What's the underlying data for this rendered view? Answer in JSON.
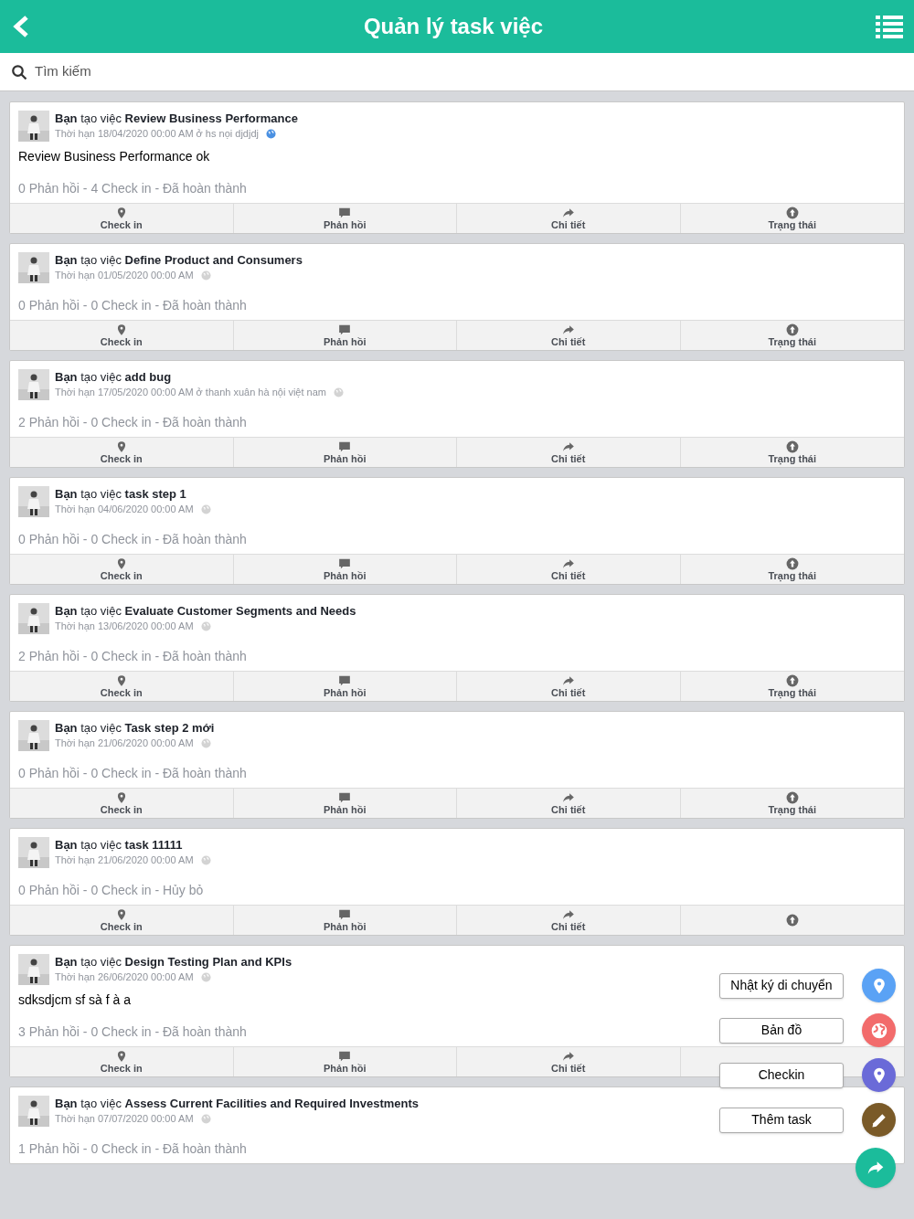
{
  "header": {
    "title": "Quản lý task việc"
  },
  "search": {
    "placeholder": "Tìm kiếm"
  },
  "tasks": [
    {
      "title": "**Bạn** tạo việc **Review Business Performance**",
      "meta": "Thời hạn 18/04/2020 00:00 AM ở hs nọi djdjdj",
      "shared": true,
      "description": "Review Business Performance ok",
      "summary": "0 Phản hồi - 4 Check in - Đã hoàn thành",
      "actions": [
        {
          "kind": "checkin",
          "label": "Check in"
        },
        {
          "kind": "reply",
          "label": "Phản hồi"
        },
        {
          "kind": "detail",
          "label": "Chi tiết"
        },
        {
          "kind": "status",
          "label": "Trạng thái"
        }
      ]
    },
    {
      "title": "**Bạn** tạo việc **Define Product and Consumers**",
      "meta": "Thời hạn 01/05/2020 00:00 AM",
      "shared": false,
      "summary": "0 Phản hồi - 0 Check in - Đã hoàn thành",
      "actions": [
        {
          "kind": "checkin",
          "label": "Check in"
        },
        {
          "kind": "reply",
          "label": "Phản hồi"
        },
        {
          "kind": "detail",
          "label": "Chi tiết"
        },
        {
          "kind": "status",
          "label": "Trạng thái"
        }
      ]
    },
    {
      "title": "**Bạn** tạo việc **add bug**",
      "meta": "Thời hạn 17/05/2020 00:00 AM ở thanh xuân hà nội việt nam",
      "shared": false,
      "summary": "2 Phản hồi - 0 Check in - Đã hoàn thành",
      "actions": [
        {
          "kind": "checkin",
          "label": "Check in"
        },
        {
          "kind": "reply",
          "label": "Phản hồi"
        },
        {
          "kind": "detail",
          "label": "Chi tiết"
        },
        {
          "kind": "status",
          "label": "Trạng thái"
        }
      ]
    },
    {
      "title": "**Bạn** tạo việc **task step 1**",
      "meta": "Thời hạn 04/06/2020 00:00 AM",
      "shared": false,
      "summary": "0 Phản hồi - 0 Check in - Đã hoàn thành",
      "actions": [
        {
          "kind": "checkin",
          "label": "Check in"
        },
        {
          "kind": "reply",
          "label": "Phản hồi"
        },
        {
          "kind": "detail",
          "label": "Chi tiết"
        },
        {
          "kind": "status",
          "label": "Trạng thái"
        }
      ]
    },
    {
      "title": "**Bạn** tạo việc **Evaluate Customer Segments and Needs**",
      "meta": "Thời hạn 13/06/2020 00:00 AM",
      "shared": false,
      "summary": "2 Phản hồi - 0 Check in - Đã hoàn thành",
      "actions": [
        {
          "kind": "checkin",
          "label": "Check in"
        },
        {
          "kind": "reply",
          "label": "Phản hồi"
        },
        {
          "kind": "detail",
          "label": "Chi tiết"
        },
        {
          "kind": "status",
          "label": "Trạng thái"
        }
      ]
    },
    {
      "title": "**Bạn** tạo việc **Task step 2 mới**",
      "meta": "Thời hạn 21/06/2020 00:00 AM",
      "shared": false,
      "summary": "0 Phản hồi - 0 Check in - Đã hoàn thành",
      "actions": [
        {
          "kind": "checkin",
          "label": "Check in"
        },
        {
          "kind": "reply",
          "label": "Phản hồi"
        },
        {
          "kind": "detail",
          "label": "Chi tiết"
        },
        {
          "kind": "status",
          "label": "Trạng thái"
        }
      ]
    },
    {
      "title": "**Bạn** tạo việc **task 11111**",
      "meta": "Thời hạn 21/06/2020 00:00 AM",
      "shared": false,
      "summary": "0 Phản hồi - 0 Check in - Hủy bỏ",
      "actions": [
        {
          "kind": "checkin",
          "label": "Check in"
        },
        {
          "kind": "reply",
          "label": "Phản hồi"
        },
        {
          "kind": "detail",
          "label": "Chi tiết"
        },
        {
          "kind": "status"
        }
      ]
    },
    {
      "title": "**Bạn** tạo việc **Design Testing Plan and KPIs**",
      "meta": "Thời hạn 26/06/2020 00:00 AM",
      "shared": false,
      "description": "sdksdjcm sf sà f à a",
      "summary": "3 Phản hồi - 0 Check in - Đã hoàn thành",
      "actions": [
        {
          "kind": "checkin",
          "label": "Check in"
        },
        {
          "kind": "reply",
          "label": "Phản hồi"
        },
        {
          "kind": "detail",
          "label": "Chi tiết"
        }
      ]
    },
    {
      "title": "**Bạn** tạo việc **Assess Current Facilities and Required Investments**",
      "meta": "Thời hạn 07/07/2020 00:00 AM",
      "shared": false,
      "summary": "1 Phản hồi - 0 Check in - Đã hoàn thành"
    }
  ],
  "fab_menu": {
    "items": [
      {
        "label": "Nhật ký di chuyển",
        "kind": "journey",
        "color": "#5aa2f5"
      },
      {
        "label": "Bản đồ",
        "kind": "map",
        "color": "#f26b6b"
      },
      {
        "label": "Checkin",
        "kind": "checkin",
        "color": "#6a6ad8"
      },
      {
        "label": "Thêm task",
        "kind": "add",
        "color": "#7a5a28"
      }
    ]
  }
}
